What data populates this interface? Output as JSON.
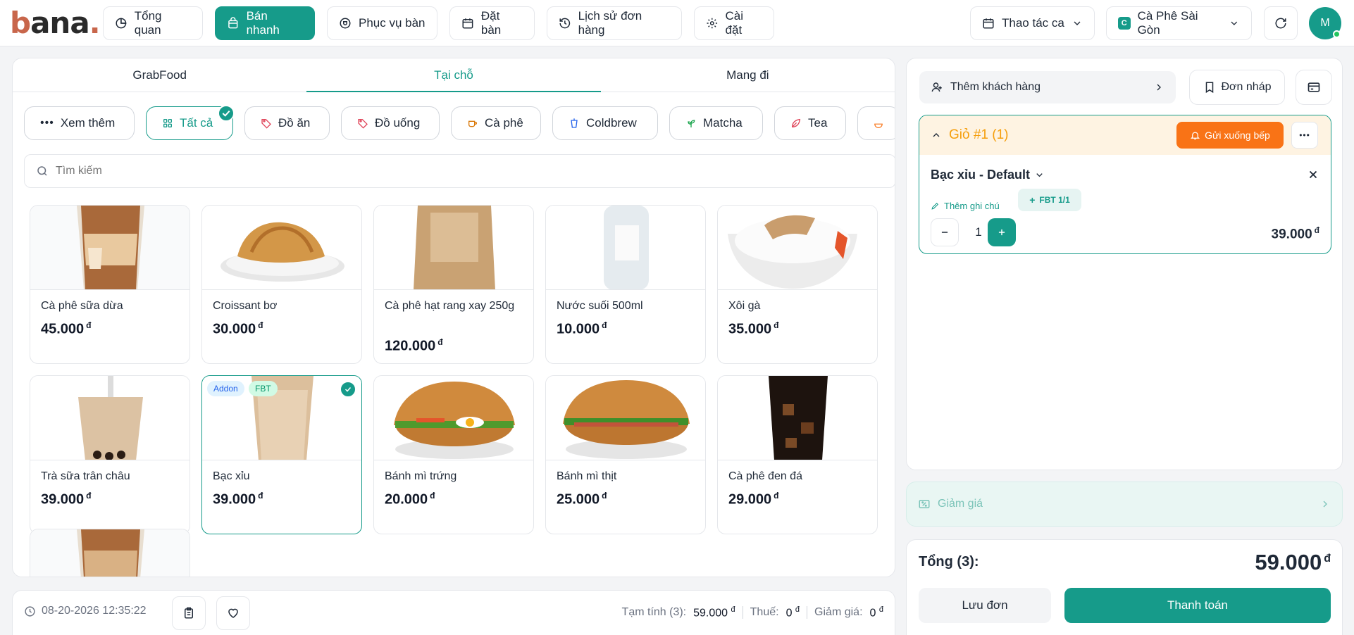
{
  "nav": {
    "items": [
      {
        "label": "Tổng quan",
        "icon": "pie-chart-icon"
      },
      {
        "label": "Bán nhanh",
        "icon": "shopping-bag-icon"
      },
      {
        "label": "Phục vụ bàn",
        "icon": "table-service-icon"
      },
      {
        "label": "Đặt bàn",
        "icon": "calendar-icon"
      },
      {
        "label": "Lịch sử đơn hàng",
        "icon": "history-icon"
      },
      {
        "label": "Cài đặt",
        "icon": "gear-icon"
      }
    ],
    "shift_label": "Thao tác ca",
    "store_badge": "C",
    "store_name": "Cà Phê Sài Gòn",
    "avatar_initial": "M"
  },
  "tabs": [
    "GrabFood",
    "Tại chỗ",
    "Mang đi"
  ],
  "categories": [
    "Xem thêm",
    "Tất cả",
    "Đồ ăn",
    "Đồ uống",
    "Cà phê",
    "Coldbrew",
    "Matcha",
    "Tea"
  ],
  "search": {
    "placeholder": "Tìm kiếm"
  },
  "products": [
    {
      "name": "Cà phê sữa dừa",
      "price": "45.000"
    },
    {
      "name": "Croissant bơ",
      "price": "30.000"
    },
    {
      "name": "Cà phê hạt rang xay 250g",
      "price": "120.000"
    },
    {
      "name": "Nước suối 500ml",
      "price": "10.000"
    },
    {
      "name": "Xôi gà",
      "price": "35.000"
    },
    {
      "name": "Trà sữa trân châu",
      "price": "39.000"
    },
    {
      "name": "Bạc xỉu",
      "price": "39.000",
      "tags": [
        "Addon",
        "FBT"
      ]
    },
    {
      "name": "Bánh mì trứng",
      "price": "20.000"
    },
    {
      "name": "Bánh mì thịt",
      "price": "25.000"
    },
    {
      "name": "Cà phê đen đá",
      "price": "29.000"
    }
  ],
  "currency": "đ",
  "footer": {
    "timestamp": "08-20-2026 12:35:22",
    "subtotal_label": "Tạm tính (3):",
    "subtotal": "59.000",
    "tax_label": "Thuế:",
    "tax": "0",
    "discount_label": "Giảm giá:",
    "discount": "0"
  },
  "cart": {
    "add_customer": "Thêm khách hàng",
    "draft": "Đơn nháp",
    "title": "Giỏ #1 (1)",
    "send_kitchen": "Gửi xuống bếp",
    "item_name": "Bạc xỉu - Default",
    "add_note": "Thêm ghi chú",
    "fbt_badge": "FBT 1/1",
    "quantity": "1",
    "line_total": "39.000"
  },
  "discount_label": "Giảm giá",
  "summary": {
    "total_label": "Tổng (3):",
    "total": "59.000",
    "save_label": "Lưu đơn",
    "pay_label": "Thanh toán"
  },
  "colors": {
    "accent": "#169b8a",
    "orange": "#f97316",
    "cart_header": "#fef3e2"
  }
}
